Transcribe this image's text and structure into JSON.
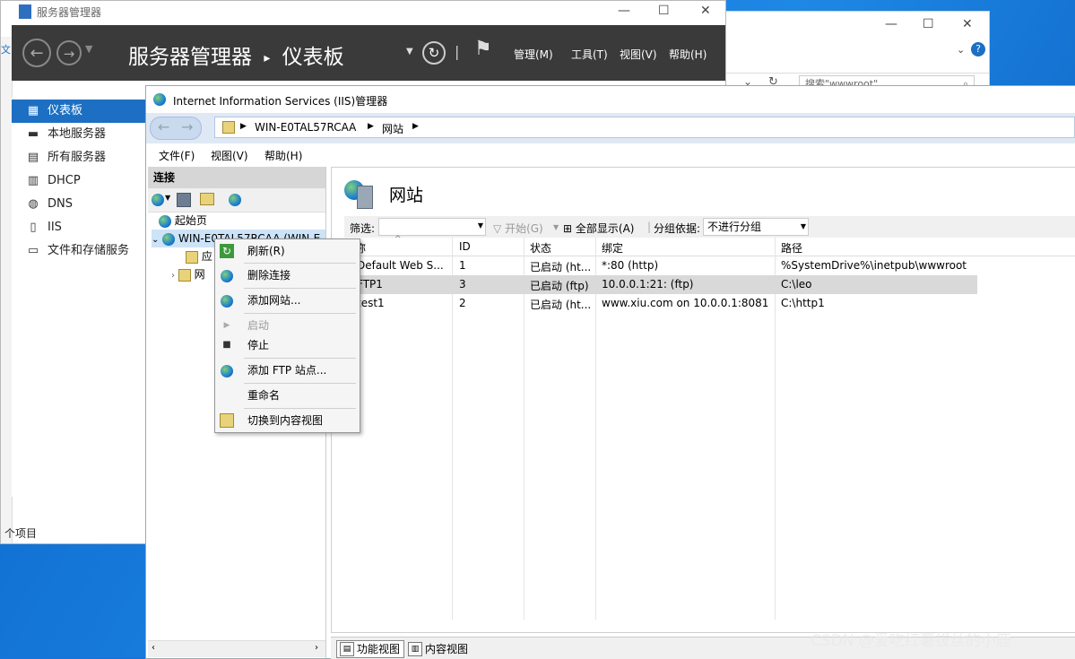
{
  "server_manager": {
    "title": "服务器管理器",
    "header_title": "服务器管理器",
    "header_sub": "仪表板",
    "menus": [
      "管理(M)",
      "工具(T)",
      "视图(V)",
      "帮助(H)"
    ],
    "side_items": [
      {
        "label": "仪表板",
        "icon": "dashboard-icon",
        "active": true
      },
      {
        "label": "本地服务器",
        "icon": "server-icon"
      },
      {
        "label": "所有服务器",
        "icon": "servers-icon"
      },
      {
        "label": "DHCP",
        "icon": "dhcp-icon"
      },
      {
        "label": "DNS",
        "icon": "dns-icon"
      },
      {
        "label": "IIS",
        "icon": "iis-icon"
      },
      {
        "label": "文件和存储服务",
        "icon": "storage-icon"
      }
    ],
    "left_hint": "文",
    "item_count": "个项目"
  },
  "explorer": {
    "search_placeholder": "搜索\"wwwroot\""
  },
  "iis": {
    "title": "Internet Information Services (IIS)管理器",
    "breadcrumb": [
      "WIN-E0TAL57RCAA",
      "网站"
    ],
    "menus": [
      "文件(F)",
      "视图(V)",
      "帮助(H)"
    ],
    "connections_title": "连接",
    "tree": {
      "start_page": "起始页",
      "server": "WIN-E0TAL57RCAA (WIN-E",
      "app_pools": "应",
      "sites": "网"
    },
    "pane_title": "网站",
    "filter": {
      "label": "筛选:",
      "start": "开始(G)",
      "show_all": "全部显示(A)",
      "group_label": "分组依据:",
      "group_value": "不进行分组"
    },
    "columns": [
      "名称",
      "ID",
      "状态",
      "绑定",
      "路径"
    ],
    "rows": [
      {
        "name": "Default Web S...",
        "id": "1",
        "status": "已启动 (ht...",
        "binding": "*:80 (http)",
        "path": "%SystemDrive%\\inetpub\\wwwroot",
        "selected": false
      },
      {
        "name": "FTP1",
        "id": "3",
        "status": "已启动 (ftp)",
        "binding": "10.0.0.1:21: (ftp)",
        "path": "C:\\leo",
        "selected": true
      },
      {
        "name": "test1",
        "id": "2",
        "status": "已启动 (ht...",
        "binding": "www.xiu.com on 10.0.0.1:8081 ...",
        "path": "C:\\http1",
        "selected": false
      }
    ],
    "tabs": [
      "功能视图",
      "内容视图"
    ]
  },
  "context_menu": {
    "items": [
      {
        "label": "刷新(R)",
        "icon": "refresh-icon",
        "disabled": false
      },
      {
        "label": "删除连接",
        "icon": "delete-connection-icon",
        "disabled": false
      },
      {
        "label": "添加网站...",
        "icon": "add-site-icon",
        "disabled": false
      },
      {
        "label": "启动",
        "icon": "start-icon",
        "disabled": true
      },
      {
        "label": "停止",
        "icon": "stop-icon",
        "disabled": false
      },
      {
        "label": "添加 FTP 站点...",
        "icon": "add-ftp-icon",
        "disabled": false
      },
      {
        "label": "重命名",
        "icon": "",
        "disabled": false
      },
      {
        "label": "切换到内容视图",
        "icon": "content-view-icon",
        "disabled": false
      }
    ]
  },
  "watermark": "CSDN @爱吃红薯拔丝的小鹿"
}
